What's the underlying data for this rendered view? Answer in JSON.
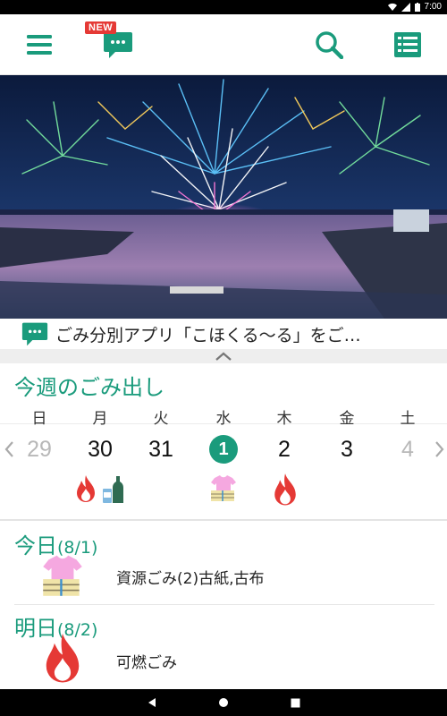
{
  "status_bar": {
    "time": "7:00"
  },
  "app_bar": {
    "menu_icon": "hamburger-icon",
    "news_badge": "NEW",
    "news_icon": "chat-bubble-icon",
    "search_icon": "search-icon",
    "list_icon": "list-icon"
  },
  "hero": {
    "description_icon": "fireworks-photo"
  },
  "news": {
    "text": "ごみ分別アプリ「こほくる〜る」をご…"
  },
  "week": {
    "title": "今週のごみ出し",
    "days_of_week": [
      "日",
      "月",
      "火",
      "水",
      "木",
      "金",
      "土"
    ],
    "dates": [
      "29",
      "30",
      "31",
      "1",
      "2",
      "3",
      "4"
    ],
    "selected_index": 3,
    "muted_indices": [
      0,
      6
    ]
  },
  "today": {
    "label": "今日",
    "date": "(8/1)",
    "item": "資源ごみ(2)古紙,古布"
  },
  "tomorrow": {
    "label": "明日",
    "date": "(8/2)",
    "item": "可燃ごみ"
  },
  "colors": {
    "accent": "#1a9b7c",
    "fire": "#e53935",
    "badge": "#e53935"
  }
}
